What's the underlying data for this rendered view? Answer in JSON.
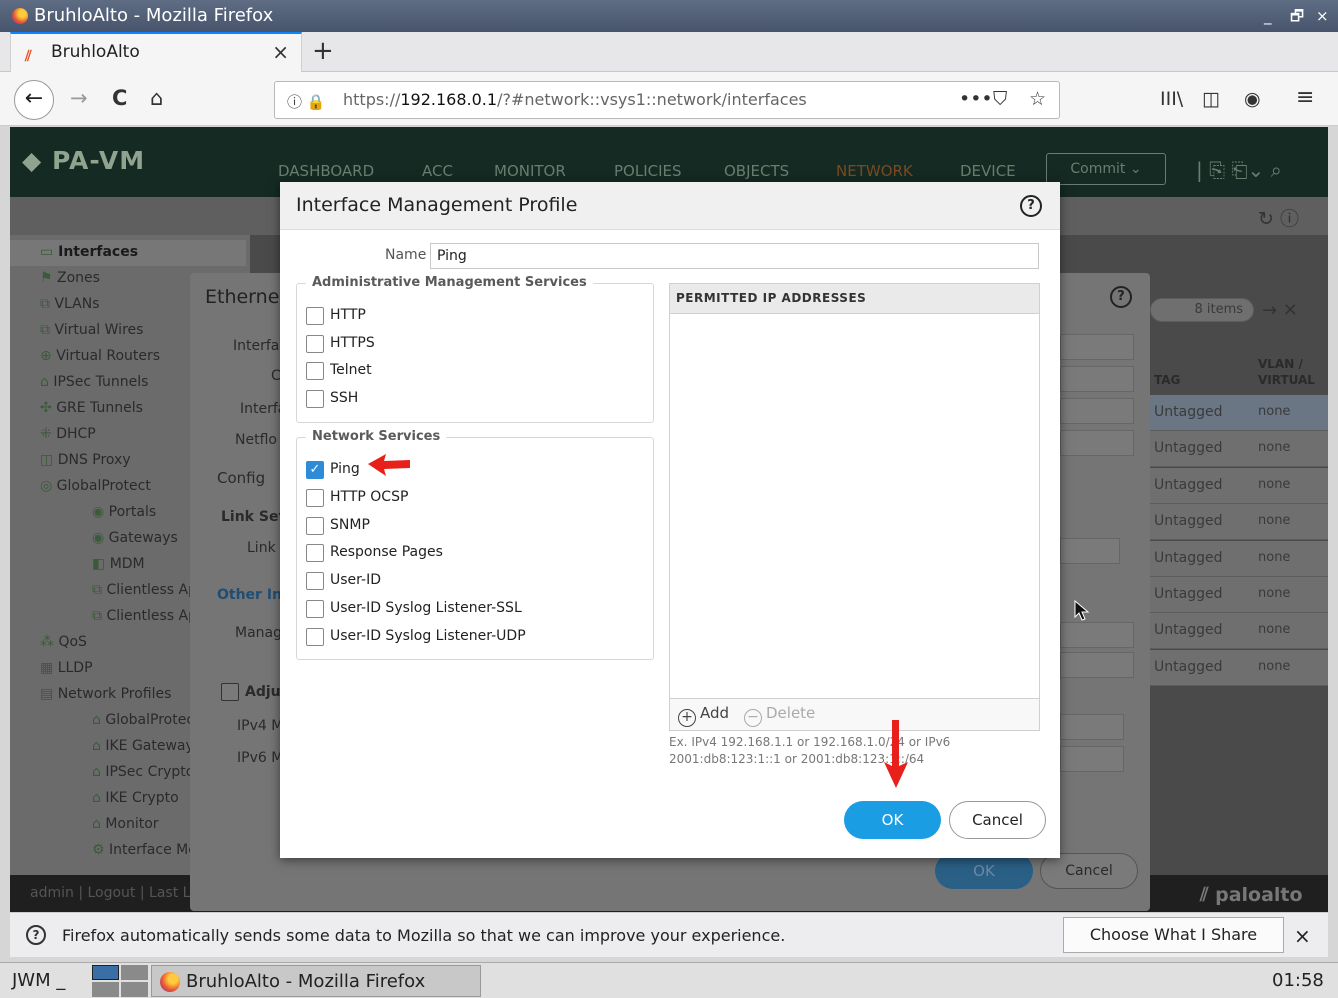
{
  "window": {
    "title": "BruhloAlto - Mozilla Firefox",
    "controls": [
      "_",
      "🗗",
      "×"
    ]
  },
  "tab": {
    "title": "BruhloAlto",
    "close": "×",
    "new_tab": "+"
  },
  "nav": {
    "back": "←",
    "forward": "→",
    "reload": "C",
    "home": "⌂",
    "url_prefix": "https://",
    "url_host": "192.168.0.1",
    "url_path": "/?#network::vsys1::network/interfaces",
    "page_actions": "•••",
    "pocket": "⛉",
    "bookmark": "☆",
    "library": "III\\",
    "sidebar": "◫",
    "account": "◉",
    "menu": "≡"
  },
  "pa": {
    "logo": "PA-VM",
    "tabs": [
      "DASHBOARD",
      "ACC",
      "MONITOR",
      "POLICIES",
      "OBJECTS",
      "NETWORK",
      "DEVICE"
    ],
    "commit": "Commit ⌄",
    "brand": "paloalto",
    "footer": "admin | Logout | Last L",
    "sidebar": [
      {
        "label": "Interfaces",
        "level": 0
      },
      {
        "label": "Zones",
        "level": 0
      },
      {
        "label": "VLANs",
        "level": 0
      },
      {
        "label": "Virtual Wires",
        "level": 0
      },
      {
        "label": "Virtual Routers",
        "level": 0
      },
      {
        "label": "IPSec Tunnels",
        "level": 0
      },
      {
        "label": "GRE Tunnels",
        "level": 0
      },
      {
        "label": "DHCP",
        "level": 0
      },
      {
        "label": "DNS Proxy",
        "level": 0
      },
      {
        "label": "GlobalProtect",
        "level": 0
      },
      {
        "label": "Portals",
        "level": 1
      },
      {
        "label": "Gateways",
        "level": 1
      },
      {
        "label": "MDM",
        "level": 1
      },
      {
        "label": "Clientless Apps",
        "level": 1
      },
      {
        "label": "Clientless App",
        "level": 1
      },
      {
        "label": "QoS",
        "level": 0
      },
      {
        "label": "LLDP",
        "level": 0
      },
      {
        "label": "Network Profiles",
        "level": 0
      },
      {
        "label": "GlobalProtect I",
        "level": 1
      },
      {
        "label": "IKE Gateways",
        "level": 1
      },
      {
        "label": "IPSec Crypto",
        "level": 1
      },
      {
        "label": "IKE Crypto",
        "level": 1
      },
      {
        "label": "Monitor",
        "level": 1
      },
      {
        "label": "Interface Mgmt",
        "level": 1
      }
    ]
  },
  "eth_dialog": {
    "title": "Etherne",
    "labels": [
      "Interfa",
      "C",
      "Interfa",
      "Netflo",
      "Config",
      "Link Setti",
      "Link",
      "Other Int",
      "Manag",
      "Adjus",
      "IPv4 M",
      "IPv6 M"
    ],
    "items_count": "8 items",
    "col_tag": "TAG",
    "col_vlan": "VLAN / VIRTUAL",
    "rows": [
      {
        "tag": "Untagged",
        "vlan": "none"
      },
      {
        "tag": "Untagged",
        "vlan": "none"
      },
      {
        "tag": "Untagged",
        "vlan": "none"
      },
      {
        "tag": "Untagged",
        "vlan": "none"
      },
      {
        "tag": "Untagged",
        "vlan": "none"
      },
      {
        "tag": "Untagged",
        "vlan": "none"
      },
      {
        "tag": "Untagged",
        "vlan": "none"
      },
      {
        "tag": "Untagged",
        "vlan": "none"
      }
    ],
    "ok": "OK",
    "cancel": "Cancel"
  },
  "modal": {
    "title": "Interface Management Profile",
    "help": "?",
    "name_label": "Name",
    "name_value": "Ping",
    "admin_legend": "Administrative Management Services",
    "admin_services": [
      {
        "label": "HTTP",
        "checked": false
      },
      {
        "label": "HTTPS",
        "checked": false
      },
      {
        "label": "Telnet",
        "checked": false
      },
      {
        "label": "SSH",
        "checked": false
      }
    ],
    "net_legend": "Network Services",
    "net_services": [
      {
        "label": "Ping",
        "checked": true
      },
      {
        "label": "HTTP OCSP",
        "checked": false
      },
      {
        "label": "SNMP",
        "checked": false
      },
      {
        "label": "Response Pages",
        "checked": false
      },
      {
        "label": "User-ID",
        "checked": false
      },
      {
        "label": "User-ID Syslog Listener-SSL",
        "checked": false
      },
      {
        "label": "User-ID Syslog Listener-UDP",
        "checked": false
      }
    ],
    "ip_header": "PERMITTED IP ADDRESSES",
    "add": "Add",
    "delete": "Delete",
    "hint_line1": "Ex. IPv4 192.168.1.1 or 192.168.1.0/24 or IPv6",
    "hint_line2": "2001:db8:123:1::1 or 2001:db8:123:1::/64",
    "ok": "OK",
    "cancel": "Cancel"
  },
  "notification": {
    "text": "Firefox automatically sends some data to Mozilla so that we can improve your experience.",
    "button": "Choose What I Share",
    "close": "×"
  },
  "taskbar": {
    "wm": "JWM",
    "sep": "_",
    "window_title": "BruhloAlto - Mozilla Firefox",
    "clock": "01:58"
  },
  "colors": {
    "primary_button": "#1a9de2",
    "annotation": "#e8201b",
    "checkbox_on": "#2d8bd8"
  }
}
